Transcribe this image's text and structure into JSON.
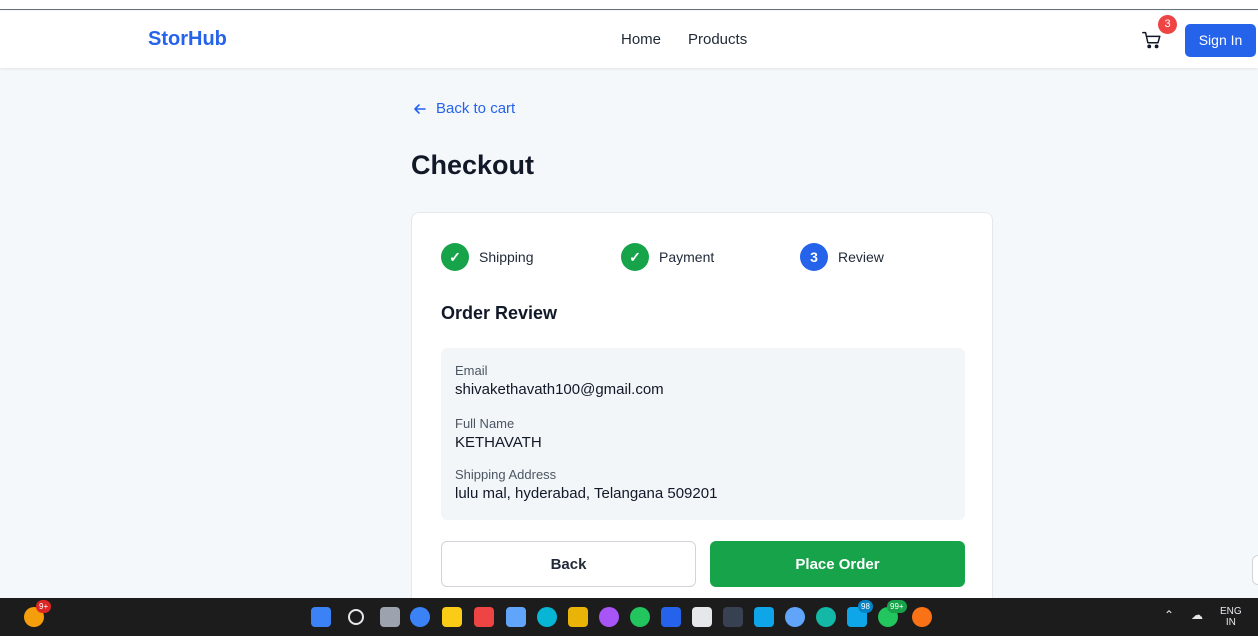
{
  "app": {
    "brand": "StorHub",
    "nav": [
      {
        "label": "Home"
      },
      {
        "label": "Products"
      }
    ],
    "cart_count": "3",
    "signin_label": "Sign In"
  },
  "checkout": {
    "back_label": "Back to cart",
    "title": "Checkout",
    "steps": [
      {
        "label": "Shipping",
        "state": "done",
        "mark": "✓"
      },
      {
        "label": "Payment",
        "state": "done",
        "mark": "✓"
      },
      {
        "label": "Review",
        "state": "current",
        "mark": "3"
      }
    ],
    "section_title": "Order Review",
    "review": {
      "email_label": "Email",
      "email_value": "shivakethavath100@gmail.com",
      "name_label": "Full Name",
      "name_value": "KETHAVATH",
      "address_label": "Shipping Address",
      "address_value": "lulu mal, hyderabad, Telangana 509201"
    },
    "back_button": "Back",
    "place_order_button": "Place Order"
  },
  "taskbar": {
    "badge_weather": "9+",
    "badge_app_98": "98",
    "badge_whatsapp": "99+",
    "language_line1": "ENG",
    "language_line2": "IN",
    "colors": {
      "accent": "#2563eb",
      "success": "#16a34a",
      "danger": "#ef4444"
    }
  }
}
